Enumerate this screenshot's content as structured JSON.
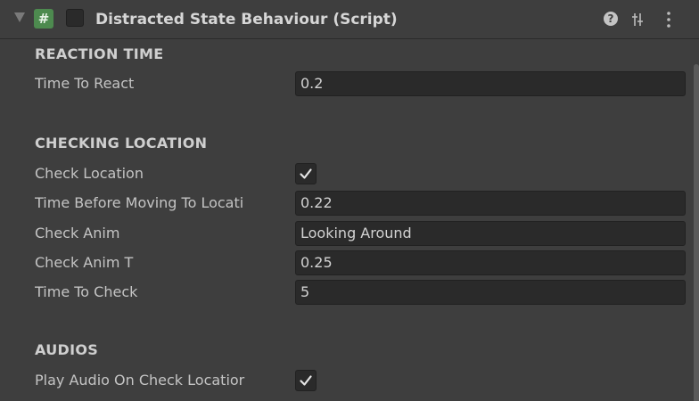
{
  "component": {
    "title": "Distracted State Behaviour (Script)",
    "script_icon_glyph": "#",
    "icons": [
      "fold-arrow-icon",
      "script-icon",
      "help-icon",
      "presets-icon",
      "kebab-menu-icon"
    ]
  },
  "sections": {
    "reaction_time": {
      "header": "REACTION TIME",
      "time_to_react": {
        "label": "Time To React",
        "value": "0.2"
      }
    },
    "checking_location": {
      "header": "CHECKING LOCATION",
      "check_location": {
        "label": "Check Location",
        "checked": true
      },
      "time_before_moving": {
        "label": "Time Before Moving To Locati",
        "value": "0.22"
      },
      "check_anim": {
        "label": "Check Anim",
        "value": "Looking Around"
      },
      "check_anim_t": {
        "label": "Check Anim T",
        "value": "0.25"
      },
      "time_to_check": {
        "label": "Time To Check",
        "value": "5"
      }
    },
    "audios": {
      "header": "AUDIOS",
      "play_audio": {
        "label": "Play Audio On Check Locatior",
        "checked": true
      }
    }
  },
  "colors": {
    "background": "#3e3e3e",
    "field_background": "#2a2a2a",
    "text": "#c4c4c4",
    "script_icon": "#4d8a4f"
  }
}
